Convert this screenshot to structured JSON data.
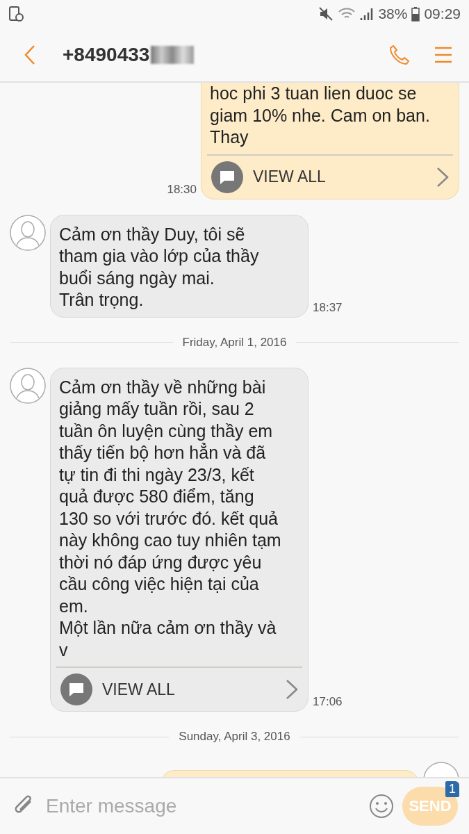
{
  "status_bar": {
    "battery": "38%",
    "time": "09:29"
  },
  "header": {
    "contact": "+8490433"
  },
  "messages": [
    {
      "kind": "outgoing",
      "text": "hoc phi 3 tuan lien duoc se giam 10% nhe. Cam on ban. Thay",
      "view_all": "VIEW ALL",
      "time": "18:30"
    },
    {
      "kind": "incoming",
      "text": "Cảm ơn thầy Duy, tôi sẽ tham gia vào lớp của thầy buổi sáng ngày mai.\nTrân trọng.",
      "time": "18:37"
    },
    {
      "kind": "date",
      "text": "Friday, April 1, 2016"
    },
    {
      "kind": "incoming",
      "text": "Cảm ơn thầy về những bài giảng mấy tuần rồi, sau 2 tuần ôn luyện cùng thầy em thấy tiến bộ hơn hẳn và đã tự tin đi thi ngày 23/3, kết quả được 580 điểm, tăng 130 so với trước đó. kết quả này không cao tuy nhiên tạm thời nó đáp ứng được yêu cầu công việc hiện tại của em.\nMột lần nữa cảm ơn thầy và v",
      "view_all": "VIEW ALL",
      "time": "17:06"
    },
    {
      "kind": "date",
      "text": "Sunday, April 3, 2016"
    },
    {
      "kind": "outgoing"
    }
  ],
  "composer": {
    "placeholder": "Enter message",
    "send": "SEND",
    "badge": "1"
  }
}
